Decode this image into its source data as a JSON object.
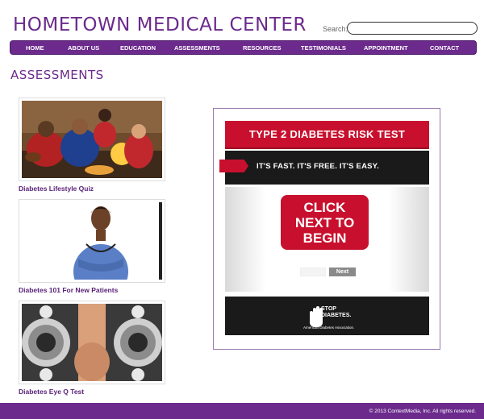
{
  "site": {
    "title": "HOMETOWN MEDICAL CENTER"
  },
  "search": {
    "label": "Search:",
    "value": "",
    "placeholder": ""
  },
  "nav": {
    "items": [
      {
        "label": "HOME"
      },
      {
        "label": "ABOUT US"
      },
      {
        "label": "EDUCATION"
      },
      {
        "label": "ASSESSMENTS"
      },
      {
        "label": "RESOURCES"
      },
      {
        "label": "TESTIMONIALS"
      },
      {
        "label": "APPOINTMENT"
      },
      {
        "label": "CONTACT"
      }
    ]
  },
  "page": {
    "title": "ASSESSMENTS"
  },
  "assessments": [
    {
      "label": "Diabetes Lifestyle Quiz",
      "image": "sports-fans-photo"
    },
    {
      "label": "Diabetes 101 For New Patients",
      "image": "nurse-photo"
    },
    {
      "label": "Diabetes Eye Q Test",
      "image": "eye-exam-photo"
    }
  ],
  "widget": {
    "title": "TYPE 2 DIABETES RISK TEST",
    "tagline": "IT'S FAST. IT'S FREE. IT'S EASY.",
    "cta": "CLICK NEXT TO BEGIN",
    "cta_lines": [
      "CLICK",
      "NEXT TO",
      "BEGIN"
    ],
    "next_label": "Next",
    "footer_brand_line1": "STOP",
    "footer_brand_line2": "DIABETES.",
    "footer_org": "American Diabetes Association."
  },
  "footer": {
    "copyright": "© 2013 ContextMedia, Inc. All rights reserved."
  },
  "colors": {
    "brand_purple": "#6b2a8c",
    "ada_red": "#c8102e",
    "dark": "#1a1a1a"
  }
}
